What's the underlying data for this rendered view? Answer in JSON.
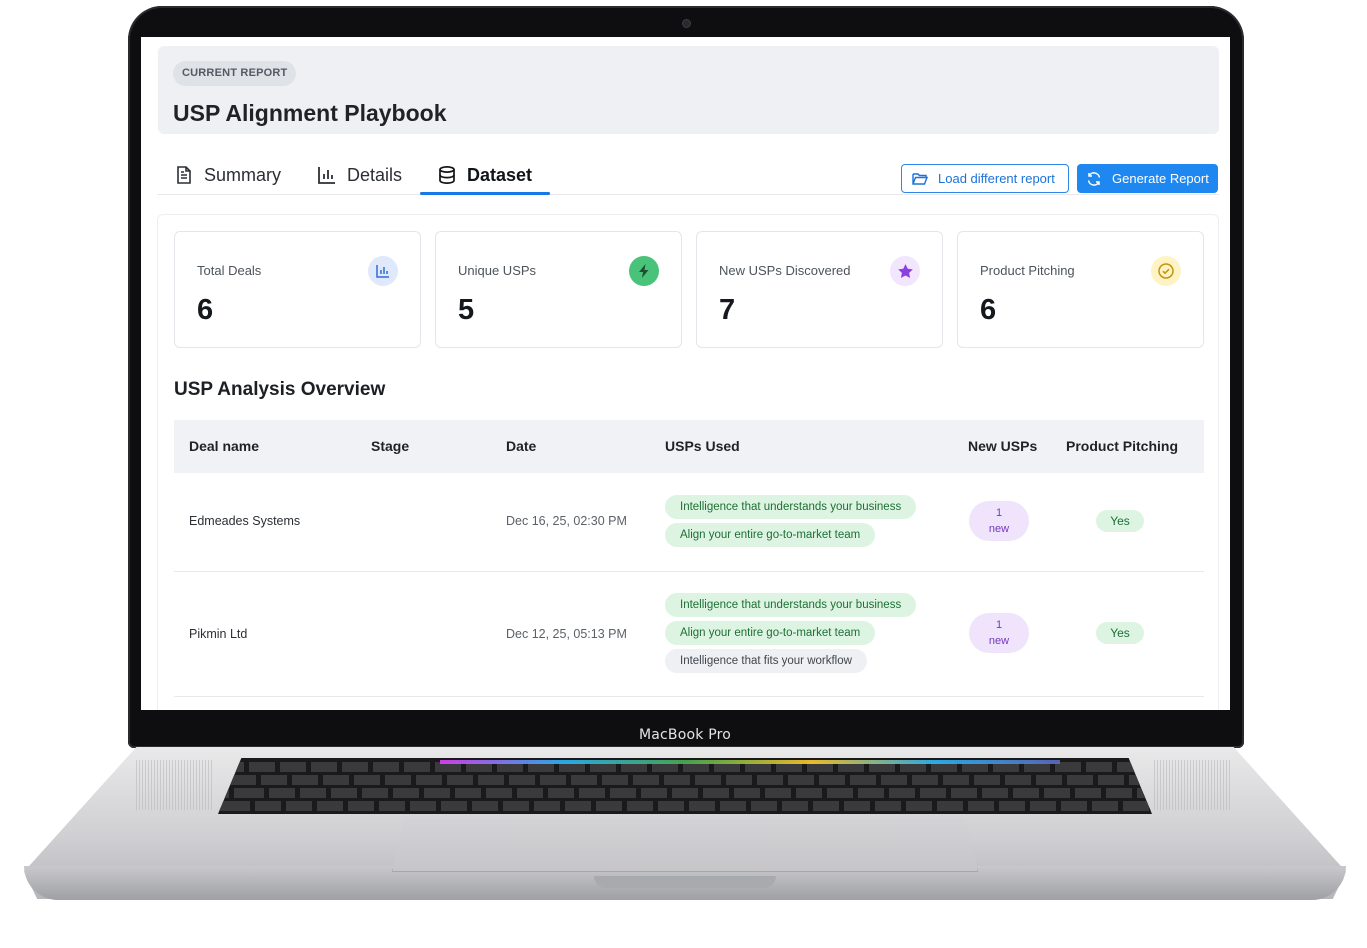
{
  "device": {
    "brand": "MacBook Pro"
  },
  "report": {
    "badge": "CURRENT REPORT",
    "title": "USP Alignment Playbook"
  },
  "tabs": [
    {
      "label": "Summary",
      "icon": "document-icon",
      "active": false
    },
    {
      "label": "Details",
      "icon": "bar-chart-icon",
      "active": false
    },
    {
      "label": "Dataset",
      "icon": "database-icon",
      "active": true
    }
  ],
  "actions": {
    "load_label": "Load different report",
    "generate_label": "Generate Report"
  },
  "stats": [
    {
      "label": "Total Deals",
      "value": "6",
      "icon": "bar-chart-icon",
      "color": "#2f6fd6"
    },
    {
      "label": "Unique USPs",
      "value": "5",
      "icon": "lightning-icon",
      "color": "#2fa55a"
    },
    {
      "label": "New USPs Discovered",
      "value": "7",
      "icon": "star-icon",
      "color": "#8b3fe0"
    },
    {
      "label": "Product Pitching",
      "value": "6",
      "icon": "check-circle-icon",
      "color": "#d7a20f"
    }
  ],
  "analysis": {
    "title": "USP Analysis Overview",
    "columns": [
      "Deal name",
      "Stage",
      "Date",
      "USPs Used",
      "New USPs",
      "Product Pitching"
    ],
    "rows": [
      {
        "deal": "Edmeades Systems",
        "stage": "",
        "date": "Dec 16, 25, 02:30 PM",
        "usps": [
          "Intelligence that understands your business",
          "Align your entire go-to-market team"
        ],
        "new_count": "1",
        "new_label": "new",
        "pitching": "Yes"
      },
      {
        "deal": "Pikmin Ltd",
        "stage": "",
        "date": "Dec 12, 25, 05:13 PM",
        "usps": [
          "Intelligence that understands your business",
          "Align your entire go-to-market team",
          "Intelligence that fits your workflow"
        ],
        "new_count": "1",
        "new_label": "new",
        "pitching": "Yes"
      }
    ]
  }
}
